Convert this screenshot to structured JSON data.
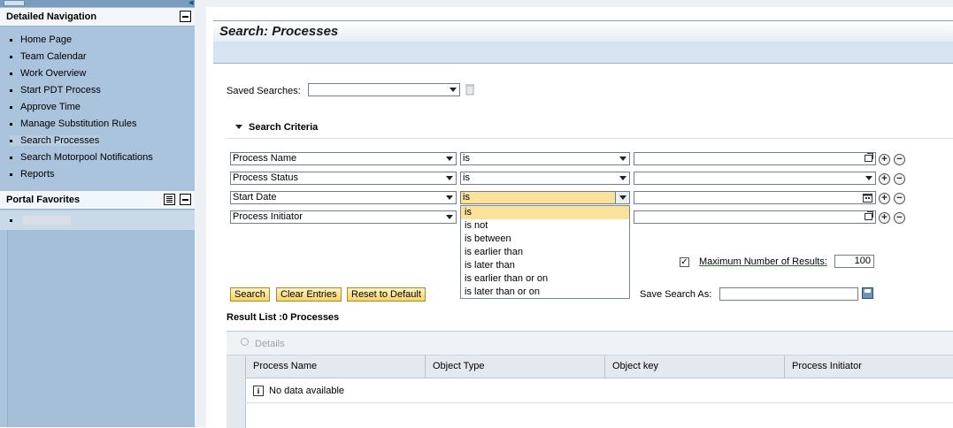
{
  "nav": {
    "section_title": "Detailed Navigation",
    "items": [
      {
        "label": "Home Page"
      },
      {
        "label": "Team Calendar"
      },
      {
        "label": "Work Overview"
      },
      {
        "label": "Start PDT Process"
      },
      {
        "label": "Approve Time"
      },
      {
        "label": "Manage Substitution Rules"
      },
      {
        "label": "Search Processes"
      },
      {
        "label": "Search Motorpool Notifications"
      },
      {
        "label": "Reports"
      }
    ],
    "active_item": "Search Processes",
    "favorites_title": "Portal Favorites"
  },
  "page": {
    "title": "Search: Processes",
    "saved_searches_label": "Saved Searches:",
    "saved_searches_value": "",
    "search_criteria_label": "Search Criteria",
    "criteria": [
      {
        "field": "Process Name",
        "operator": "is",
        "value": ""
      },
      {
        "field": "Process Status",
        "operator": "is",
        "value": ""
      },
      {
        "field": "Start Date",
        "operator": "is",
        "value": ""
      },
      {
        "field": "Process Initiator",
        "operator": "",
        "value": ""
      }
    ],
    "operator_options": [
      "is",
      "is not",
      "is between",
      "is earlier than",
      "is later than",
      "is earlier than or on",
      "is later than or on"
    ],
    "selected_operator": "is",
    "max_results_checked": true,
    "max_results_label": "Maximum Number of Results:",
    "max_results_value": "100",
    "buttons": {
      "search": "Search",
      "clear": "Clear Entries",
      "reset": "Reset to Default"
    },
    "save_search_label": "Save Search As:",
    "save_search_value": ""
  },
  "results": {
    "title": "Result List :0 Processes",
    "toolbar_details": "Details",
    "columns": [
      "Process Name",
      "Object Type",
      "Object key",
      "Process Initiator"
    ],
    "empty_text": "No data available"
  },
  "colors": {
    "nav_bg": "#a9c4dc",
    "button_bg": "#f6d366",
    "popup_selected": "#fbe29a"
  }
}
